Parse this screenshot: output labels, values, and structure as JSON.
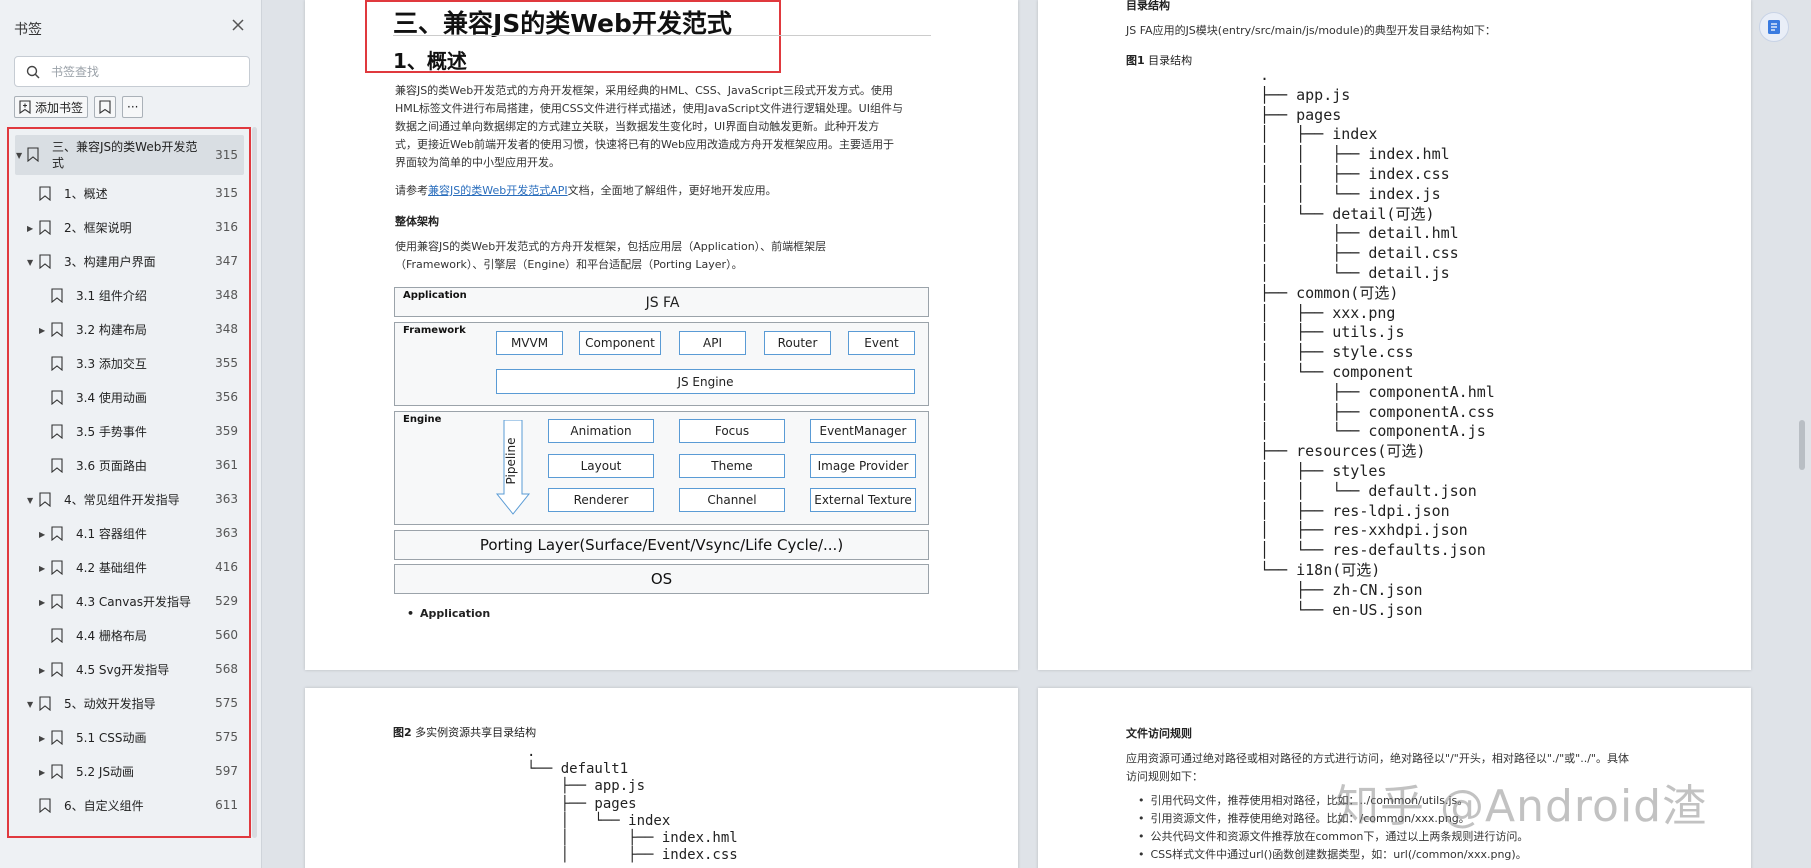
{
  "sidebar": {
    "title": "书签",
    "search_placeholder": "书签查找",
    "add_bookmark_label": "添加书签",
    "more_label": "···",
    "items": [
      {
        "label": "三、兼容JS的类Web开发范式",
        "page": "315",
        "expander": "▼",
        "selected": true
      },
      {
        "label": "1、概述",
        "page": "315",
        "expander": ""
      },
      {
        "label": "2、框架说明",
        "page": "316",
        "expander": "▶"
      },
      {
        "label": "3、构建用户界面",
        "page": "347",
        "expander": "▼"
      },
      {
        "label": "3.1 组件介绍",
        "page": "348",
        "expander": ""
      },
      {
        "label": "3.2 构建布局",
        "page": "348",
        "expander": "▶"
      },
      {
        "label": "3.3 添加交互",
        "page": "355",
        "expander": ""
      },
      {
        "label": "3.4 使用动画",
        "page": "356",
        "expander": ""
      },
      {
        "label": "3.5 手势事件",
        "page": "359",
        "expander": ""
      },
      {
        "label": "3.6 页面路由",
        "page": "361",
        "expander": ""
      },
      {
        "label": "4、常见组件开发指导",
        "page": "363",
        "expander": "▼"
      },
      {
        "label": "4.1 容器组件",
        "page": "363",
        "expander": "▶"
      },
      {
        "label": "4.2 基础组件",
        "page": "416",
        "expander": "▶"
      },
      {
        "label": "4.3 Canvas开发指导",
        "page": "529",
        "expander": "▶"
      },
      {
        "label": "4.4 栅格布局",
        "page": "560",
        "expander": ""
      },
      {
        "label": "4.5 Svg开发指导",
        "page": "568",
        "expander": "▶"
      },
      {
        "label": "5、动效开发指导",
        "page": "575",
        "expander": "▼"
      },
      {
        "label": "5.1 CSS动画",
        "page": "575",
        "expander": "▶"
      },
      {
        "label": "5.2 JS动画",
        "page": "597",
        "expander": "▶"
      },
      {
        "label": "6、自定义组件",
        "page": "611",
        "expander": ""
      }
    ]
  },
  "page1": {
    "heading": "三、兼容JS的类Web开发范式",
    "subheading": "1、概述",
    "para1": [
      "兼容JS的类Web开发范式的方舟开发框架，采用经典的HML、CSS、JavaScript三段式开发方式。使用",
      "HML标签文件进行布局搭建，使用CSS文件进行样式描述，使用JavaScript文件进行逻辑处理。UI组件与",
      "数据之间通过单向数据绑定的方式建立关联，当数据发生变化时，UI界面自动触发更新。此种开发方",
      "式，更接近Web前端开发者的使用习惯，快速将已有的Web应用改造成方舟开发框架应用。主要适用于",
      "界面较为简单的中小型应用开发。"
    ],
    "ref_prefix": "请参考",
    "ref_link": "兼容JS的类Web开发范式API",
    "ref_suffix": "文档，全面地了解组件，更好地开发应用。",
    "arch_title": "整体架构",
    "arch_desc": [
      "使用兼容JS的类Web开发范式的方舟开发框架，包括应用层（Application）、前端框架层",
      "（Framework）、引擎层（Engine）和平台适配层（Porting Layer）。"
    ],
    "diagram": {
      "app_label": "Application",
      "app_content": "JS FA",
      "fw_label": "Framework",
      "fw_cells": [
        "MVVM",
        "Component",
        "API",
        "Router",
        "Event"
      ],
      "fw_engine": "JS Engine",
      "engine_label": "Engine",
      "pipeline": "Pipeline",
      "engine_cells": [
        "Animation",
        "Focus",
        "EventManager",
        "Layout",
        "Theme",
        "Image Provider",
        "Renderer",
        "Channel",
        "External Texture"
      ],
      "porting": "Porting Layer(Surface/Event/Vsync/Life Cycle/...)",
      "os": "OS"
    },
    "bullet": "Application"
  },
  "page2": {
    "section_title": "目录结构",
    "intro": "JS FA应用的JS模块(entry/src/main/js/module)的典型开发目录结构如下：",
    "fig_label": "图1",
    "fig_title": "目录结构",
    "tree": [
      ".",
      "├── app.js",
      "├── pages",
      "│   ├── index",
      "│   │   ├── index.hml",
      "│   │   ├── index.css",
      "│   │   └── index.js",
      "│   └── detail(可选)",
      "│       ├── detail.hml",
      "│       ├── detail.css",
      "│       └── detail.js",
      "├── common(可选)",
      "│   ├── xxx.png",
      "│   ├── utils.js",
      "│   ├── style.css",
      "│   └── component",
      "│       ├── componentA.hml",
      "│       ├── componentA.css",
      "│       └── componentA.js",
      "├── resources(可选)",
      "│   ├── styles",
      "│   │   └── default.json",
      "│   ├── res-ldpi.json",
      "│   ├── res-xxhdpi.json",
      "│   └── res-defaults.json",
      "└── i18n(可选)",
      "    ├── zh-CN.json",
      "    └── en-US.json"
    ]
  },
  "page3": {
    "fig_label": "图2",
    "fig_title": "多实例资源共享目录结构",
    "tree": [
      ".",
      "└── default1",
      "    ├── app.js",
      "    ├── pages",
      "    │   └── index",
      "    │       ├── index.hml",
      "    │       ├── index.css"
    ]
  },
  "page4": {
    "section_title": "文件访问规则",
    "para": [
      "应用资源可通过绝对路径或相对路径的方式进行访问，绝对路径以\"/\"开头，相对路径以\"./\"或\"../\"。具体",
      "访问规则如下："
    ],
    "bullets": [
      "引用代码文件，推荐使用相对路径，比如：../common/utils.js。",
      "引用资源文件，推荐使用绝对路径。比如：/common/xxx.png。",
      "公共代码文件和资源文件推荐放在common下，通过以上两条规则进行访问。",
      "CSS样式文件中通过url()函数创建数据类型，如：url(/common/xxx.png)。"
    ]
  },
  "watermark": "知乎 @Android渣",
  "colors": {
    "accent_red": "#e0393e",
    "link_blue": "#2a6ebd",
    "diagram_blue": "#5a9bd5"
  }
}
